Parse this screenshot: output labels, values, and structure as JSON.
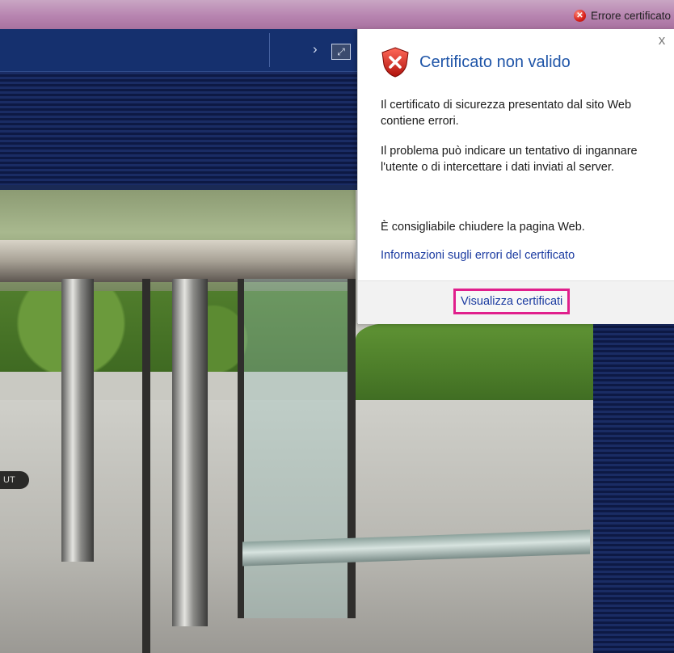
{
  "browser": {
    "cert_error_label": "Errore certificato",
    "colors": {
      "topbar": "#b784b0",
      "error_red": "#d8211b"
    }
  },
  "app": {
    "header_chevron": "›",
    "fullscreen_icon": "fullscreen-icon",
    "camera_label": "UT"
  },
  "popup": {
    "title": "Certificato non valido",
    "message1": "Il certificato di sicurezza presentato dal sito Web contiene errori.",
    "message2": "Il problema può indicare un tentativo di ingannare l'utente o di intercettare i dati inviati al server.",
    "message3": "È consigliabile chiudere la pagina Web.",
    "info_link": "Informazioni sugli errori del certificato",
    "view_button": "Visualizza certificati",
    "close_symbol": "x",
    "icons": {
      "shield": "shield-error-icon",
      "close": "close-icon"
    },
    "colors": {
      "title": "#1f55a8",
      "link": "#1a3aa0",
      "highlight": "#e01f8c"
    }
  }
}
